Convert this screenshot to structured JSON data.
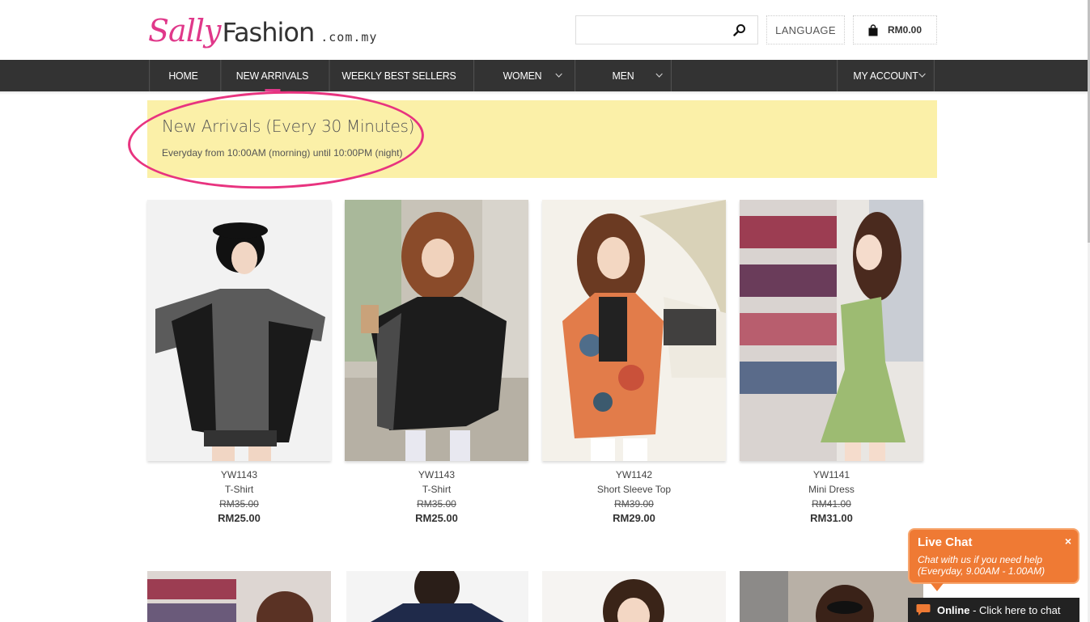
{
  "header": {
    "logo": {
      "part1": "Sally",
      "part2": "Fashion",
      "part3": ".com.my"
    },
    "search": {
      "value": "",
      "placeholder": ""
    },
    "language_label": "LANGUAGE",
    "cart_total": "RM0.00"
  },
  "nav": {
    "items": [
      {
        "label": "HOME"
      },
      {
        "label": "NEW ARRIVALS"
      },
      {
        "label": "WEEKLY BEST SELLERS"
      },
      {
        "label": "WOMEN"
      },
      {
        "label": "MEN"
      },
      {
        "label": "MY ACCOUNT"
      }
    ]
  },
  "banner": {
    "title": "New Arrivals (Every 30 Minutes)",
    "subtitle": "Everyday from 10:00AM (morning) until 10:00PM (night)"
  },
  "products": [
    {
      "code": "YW1143",
      "name": "T-Shirt",
      "old_price": "RM35.00",
      "new_price": "RM25.00"
    },
    {
      "code": "YW1143",
      "name": "T-Shirt",
      "old_price": "RM35.00",
      "new_price": "RM25.00"
    },
    {
      "code": "YW1142",
      "name": "Short Sleeve Top",
      "old_price": "RM39.00",
      "new_price": "RM29.00"
    },
    {
      "code": "YW1141",
      "name": "Mini Dress",
      "old_price": "RM41.00",
      "new_price": "RM31.00"
    }
  ],
  "live_chat": {
    "title": "Live Chat",
    "close": "×",
    "message_line1": "Chat with us if you need help",
    "message_line2": "(Everyday, 9.00AM - 1.00AM)",
    "status": "Online",
    "status_action": "- Click here to chat"
  },
  "colors": {
    "brand_pink": "#e0388a",
    "nav_bg": "#333333",
    "banner_bg": "#fbf0a8",
    "chat_orange": "#ef7a34"
  },
  "icons": {
    "search": "search-icon",
    "cart": "shopping-bag-icon",
    "dropdown": "chevron-down-icon",
    "chat": "speech-bubble-icon"
  }
}
